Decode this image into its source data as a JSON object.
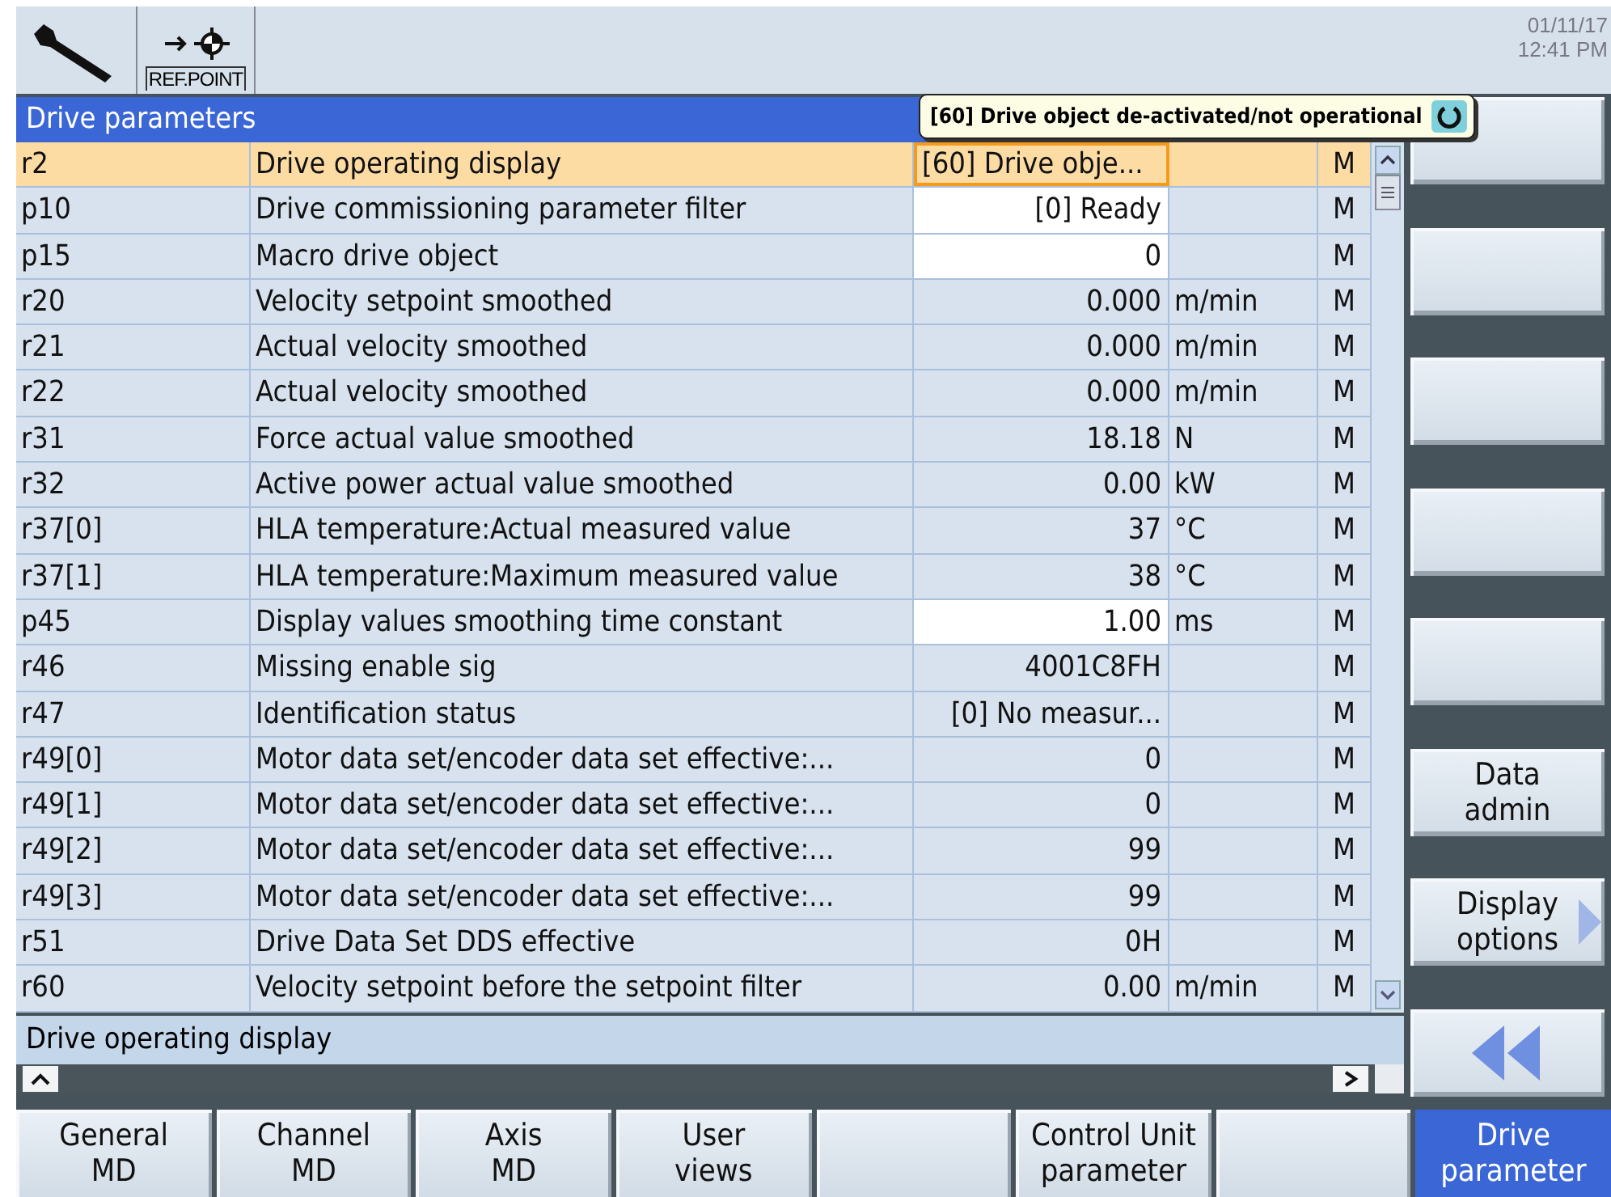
{
  "header": {
    "ref_point_label": "REF.POINT",
    "date": "01/11/17",
    "time": "12:41 PM"
  },
  "title": "Drive parameters",
  "tooltip": "[60] Drive object de-activated/not operational",
  "rows": [
    {
      "id": "r2",
      "description": "Drive operating display",
      "value": "[60] Drive obje...",
      "unit": "",
      "access": "M",
      "editable": false,
      "selected": true
    },
    {
      "id": "p10",
      "description": "Drive commissioning parameter filter",
      "value": "[0] Ready",
      "unit": "",
      "access": "M",
      "editable": true,
      "selected": false
    },
    {
      "id": "p15",
      "description": "Macro drive object",
      "value": "0",
      "unit": "",
      "access": "M",
      "editable": true,
      "selected": false
    },
    {
      "id": "r20",
      "description": "Velocity setpoint smoothed",
      "value": "0.000",
      "unit": "m/min",
      "access": "M",
      "editable": false,
      "selected": false
    },
    {
      "id": "r21",
      "description": "Actual velocity smoothed",
      "value": "0.000",
      "unit": "m/min",
      "access": "M",
      "editable": false,
      "selected": false
    },
    {
      "id": "r22",
      "description": "Actual velocity smoothed",
      "value": "0.000",
      "unit": "m/min",
      "access": "M",
      "editable": false,
      "selected": false
    },
    {
      "id": "r31",
      "description": "Force actual value smoothed",
      "value": "18.18",
      "unit": "N",
      "access": "M",
      "editable": false,
      "selected": false
    },
    {
      "id": "r32",
      "description": "Active power actual value smoothed",
      "value": "0.00",
      "unit": "kW",
      "access": "M",
      "editable": false,
      "selected": false
    },
    {
      "id": "r37[0]",
      "description": "HLA temperature:Actual measured value",
      "value": "37",
      "unit": "°C",
      "access": "M",
      "editable": false,
      "selected": false
    },
    {
      "id": "r37[1]",
      "description": "HLA temperature:Maximum measured value",
      "value": "38",
      "unit": "°C",
      "access": "M",
      "editable": false,
      "selected": false
    },
    {
      "id": "p45",
      "description": "Display values smoothing time constant",
      "value": "1.00",
      "unit": "ms",
      "access": "M",
      "editable": true,
      "selected": false
    },
    {
      "id": "r46",
      "description": "Missing enable sig",
      "value": "4001C8FH",
      "unit": "",
      "access": "M",
      "editable": false,
      "selected": false
    },
    {
      "id": "r47",
      "description": "Identification status",
      "value": "[0] No measur...",
      "unit": "",
      "access": "M",
      "editable": false,
      "selected": false
    },
    {
      "id": "r49[0]",
      "description": "Motor data set/encoder data set effective:...",
      "value": "0",
      "unit": "",
      "access": "M",
      "editable": false,
      "selected": false
    },
    {
      "id": "r49[1]",
      "description": "Motor data set/encoder data set effective:...",
      "value": "0",
      "unit": "",
      "access": "M",
      "editable": false,
      "selected": false
    },
    {
      "id": "r49[2]",
      "description": "Motor data set/encoder data set effective:...",
      "value": "99",
      "unit": "",
      "access": "M",
      "editable": false,
      "selected": false
    },
    {
      "id": "r49[3]",
      "description": "Motor data set/encoder data set effective:...",
      "value": "99",
      "unit": "",
      "access": "M",
      "editable": false,
      "selected": false
    },
    {
      "id": "r51",
      "description": "Drive Data Set DDS effective",
      "value": "0H",
      "unit": "",
      "access": "M",
      "editable": false,
      "selected": false
    },
    {
      "id": "r60",
      "description": "Velocity setpoint before the setpoint filter",
      "value": "0.00",
      "unit": "m/min",
      "access": "M",
      "editable": false,
      "selected": false
    }
  ],
  "status_line": "Drive operating display",
  "right_softkeys": [
    {
      "kind": "blank"
    },
    {
      "kind": "blank"
    },
    {
      "kind": "blank"
    },
    {
      "kind": "blank"
    },
    {
      "kind": "blank"
    },
    {
      "kind": "text",
      "lines": [
        "Data",
        "admin"
      ]
    },
    {
      "kind": "more",
      "lines": [
        "Display",
        "options"
      ]
    },
    {
      "kind": "back"
    }
  ],
  "bottom_softkeys": [
    {
      "kind": "text",
      "lines": [
        "General",
        "MD"
      ],
      "selected": false
    },
    {
      "kind": "text",
      "lines": [
        "Channel",
        "MD"
      ],
      "selected": false
    },
    {
      "kind": "text",
      "lines": [
        "Axis",
        "MD"
      ],
      "selected": false
    },
    {
      "kind": "text",
      "lines": [
        "User",
        "views"
      ],
      "selected": false
    },
    {
      "kind": "blank",
      "selected": false
    },
    {
      "kind": "text",
      "lines": [
        "Control Unit",
        "parameter"
      ],
      "selected": false
    },
    {
      "kind": "blank",
      "selected": false
    },
    {
      "kind": "text",
      "lines": [
        "Drive",
        "parameter"
      ],
      "selected": true
    }
  ]
}
